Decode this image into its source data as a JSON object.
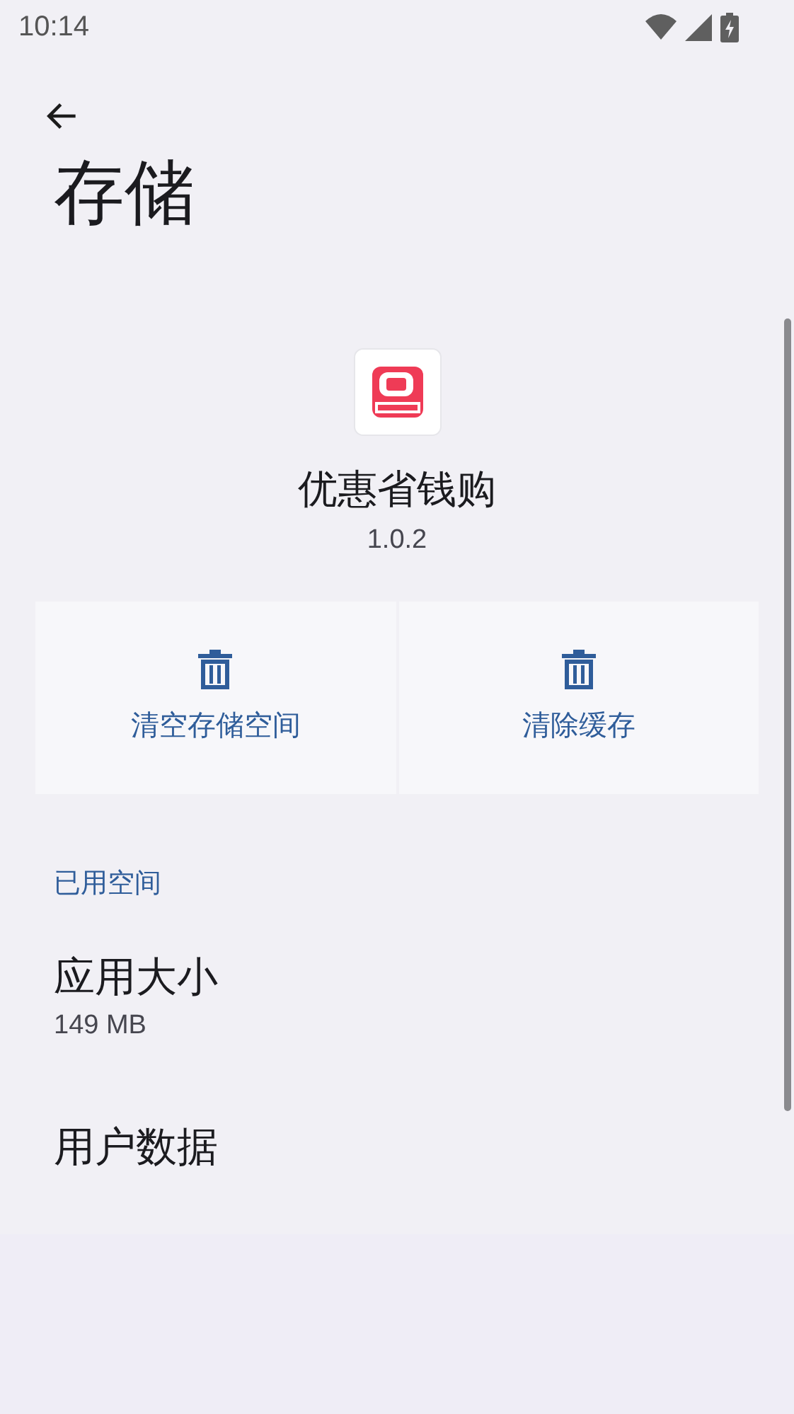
{
  "status_bar": {
    "time": "10:14"
  },
  "title": "存储",
  "app": {
    "name": "优惠省钱购",
    "version": "1.0.2"
  },
  "actions": [
    {
      "label": "清空存储空间"
    },
    {
      "label": "清除缓存"
    }
  ],
  "section": {
    "header": "已用空间",
    "items": [
      {
        "title": "应用大小",
        "summary": "149 MB"
      },
      {
        "title": "用户数据"
      }
    ]
  }
}
